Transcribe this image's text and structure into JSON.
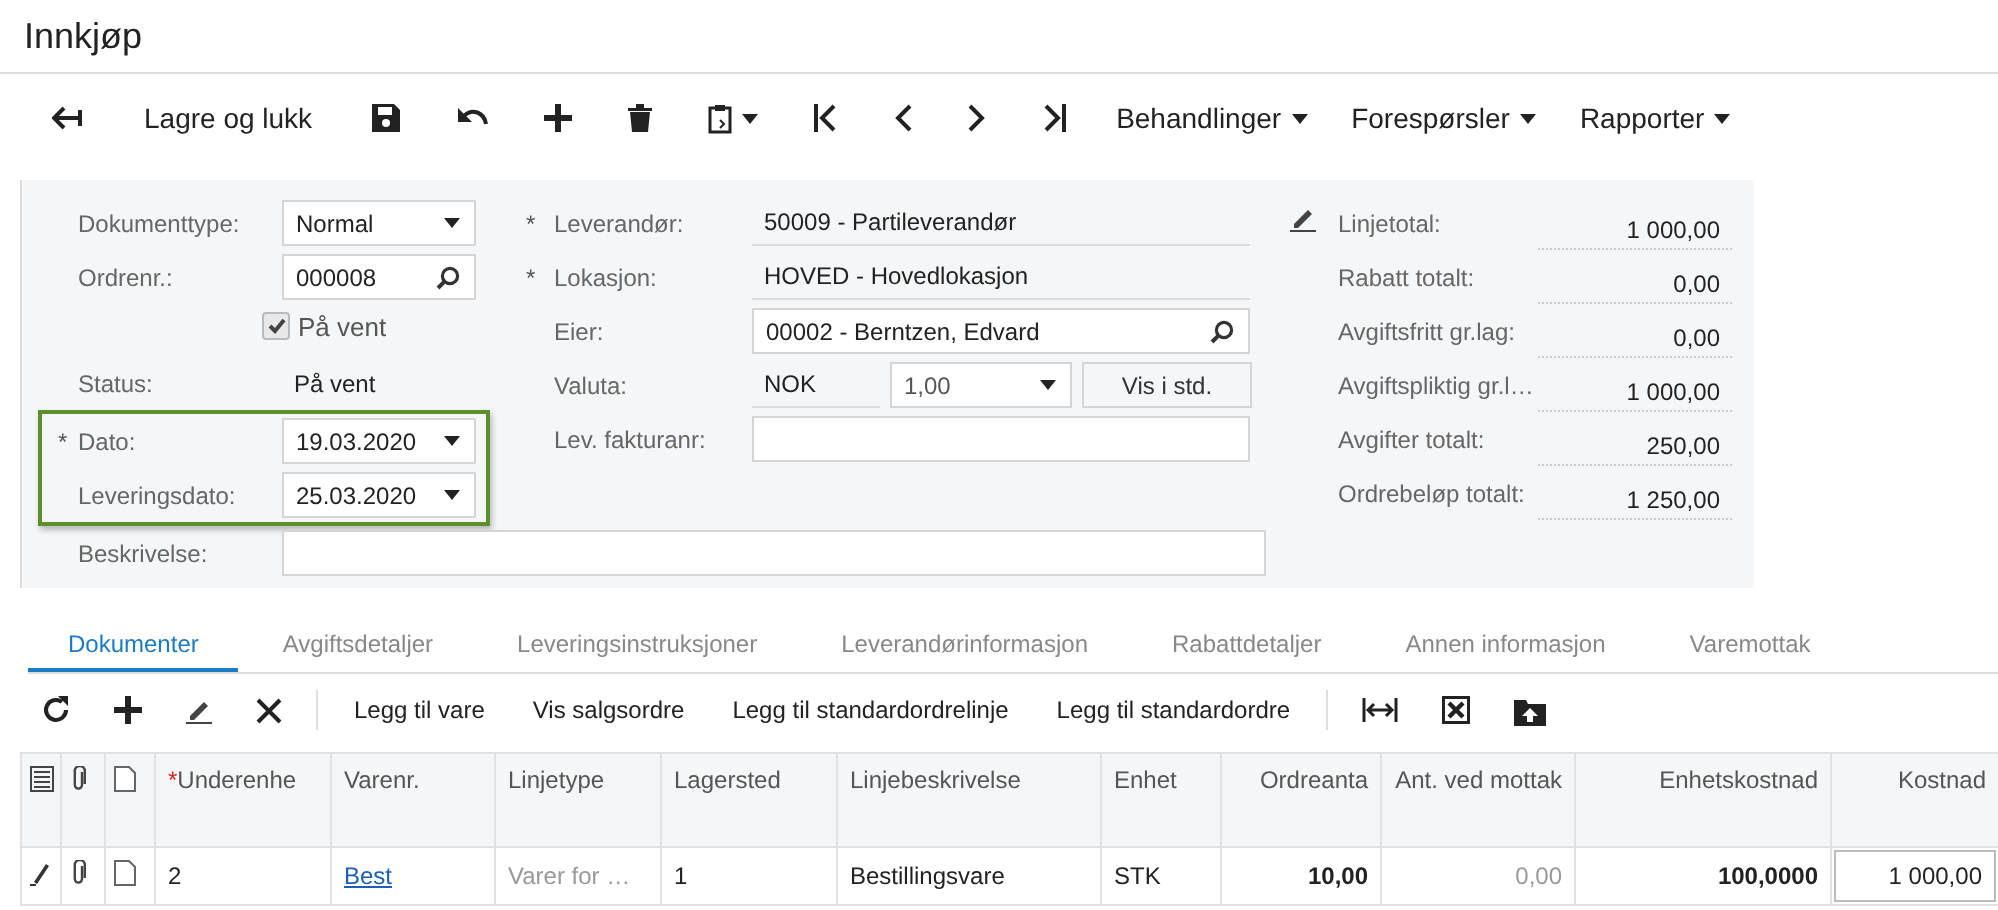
{
  "title": "Innkjøp",
  "toolbar": {
    "buttons": [
      {
        "label": "Lagre og lukk"
      }
    ],
    "menus": [
      {
        "label": "Behandlinger"
      },
      {
        "label": "Forespørsler"
      },
      {
        "label": "Rapporter"
      }
    ]
  },
  "form": {
    "left": [
      {
        "kind": "select",
        "label": "Dokumenttype:",
        "value": "Normal",
        "highlighted": false
      },
      {
        "kind": "lookup",
        "label": "Ordrenr.:",
        "value": "000008",
        "highlighted": false
      },
      {
        "kind": "checkbox",
        "label": "På vent",
        "checked": true,
        "highlighted": false
      },
      {
        "kind": "text",
        "label": "Status:",
        "value": "På vent",
        "highlighted": false
      },
      {
        "kind": "select",
        "marker": "*",
        "label": "Dato:",
        "value": "19.03.2020",
        "highlighted": true
      },
      {
        "kind": "select",
        "label": "Leveringsdato:",
        "value": "25.03.2020",
        "highlighted": true
      }
    ],
    "middle": [
      {
        "kind": "readonly",
        "marker": "*",
        "label": "Leverandør:",
        "value": "50009 - Partileverandør"
      },
      {
        "kind": "readonly",
        "marker": "*",
        "label": "Lokasjon:",
        "value": "HOVED - Hovedlokasjon"
      },
      {
        "kind": "lookup",
        "label": "Eier:",
        "value": "00002 - Berntzen, Edvard"
      },
      {
        "kind": "currency",
        "label": "Valuta:",
        "value": "NOK",
        "rate": "1,00",
        "button": "Vis i std."
      },
      {
        "kind": "input",
        "label": "Lev. fakturanr:"
      }
    ],
    "description": {
      "label": "Beskrivelse:"
    },
    "totals": [
      {
        "label": "Linjetotal:",
        "value": "1 000,00"
      },
      {
        "label": "Rabatt totalt:",
        "value": "0,00"
      },
      {
        "label": "Avgiftsfritt gr.lag:",
        "value": "0,00"
      },
      {
        "label": "Avgiftspliktig gr.l…",
        "value": "1 000,00"
      },
      {
        "label": "Avgifter totalt:",
        "value": "250,00"
      },
      {
        "label": "Ordrebeløp totalt:",
        "value": "1 250,00"
      }
    ]
  },
  "tabs": [
    {
      "label": "Dokumenter",
      "selected": true
    },
    {
      "label": "Avgiftsdetaljer",
      "selected": false
    },
    {
      "label": "Leveringsinstruksjoner",
      "selected": false
    },
    {
      "label": "Leverandørinformasjon",
      "selected": false
    },
    {
      "label": "Rabattdetaljer",
      "selected": false
    },
    {
      "label": "Annen informasjon",
      "selected": false
    },
    {
      "label": "Varemottak",
      "selected": false
    }
  ],
  "grid_toolbar": {
    "buttons": [
      {
        "label": "Legg til vare"
      },
      {
        "label": "Vis salgsordre"
      },
      {
        "label": "Legg til standardordrelinje"
      },
      {
        "label": "Legg til standardordre"
      }
    ]
  },
  "table": {
    "columns": [
      {
        "marker": "*",
        "label": "Underenhe",
        "kind": "text"
      },
      {
        "label": "Varenr.",
        "kind": "text"
      },
      {
        "label": "Linjetype",
        "kind": "text"
      },
      {
        "label": "Lagersted",
        "kind": "text"
      },
      {
        "label": "Linjebeskrivelse",
        "kind": "text"
      },
      {
        "label": "Enhet",
        "kind": "text"
      },
      {
        "label": "Ordreanta",
        "kind": "number"
      },
      {
        "label": "Ant. ved mottak",
        "kind": "number"
      },
      {
        "label": "Enhetskostnad",
        "kind": "number"
      },
      {
        "label": "Kostnad",
        "kind": "number"
      }
    ],
    "rows": [
      {
        "cells": [
          {
            "text": "2",
            "kind": "text"
          },
          {
            "text": "Best",
            "kind": "link"
          },
          {
            "text": "Varer for …",
            "kind": "muted"
          },
          {
            "text": "1",
            "kind": "text"
          },
          {
            "text": "Bestillingsvare",
            "kind": "text"
          },
          {
            "text": "STK",
            "kind": "text"
          },
          {
            "text": "10,00",
            "kind": "number"
          },
          {
            "text": "0,00",
            "kind": "muted-number"
          },
          {
            "text": "100,0000",
            "kind": "number"
          },
          {
            "text": "1 000,00",
            "kind": "input"
          }
        ]
      }
    ]
  }
}
